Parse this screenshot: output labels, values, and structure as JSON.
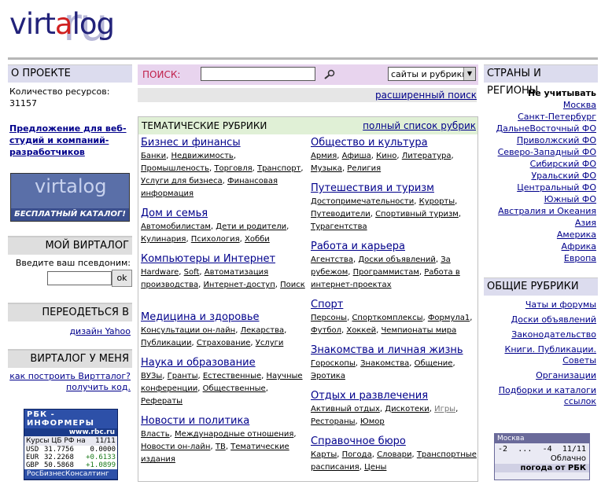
{
  "logo": {
    "main_pre": "virt",
    "main_dot": "a",
    "main_post": "log",
    "ru": "ru"
  },
  "about": {
    "header": "О ПРОЕКТЕ",
    "resources_label": "Количество ресурсов:",
    "resources_count": "31157",
    "offer_link": "Предложение для веб-студий и компаний-разработчиков",
    "banner_logo": "virtalog",
    "banner_text": "БЕСПЛАТНЫЙ КАТАЛОГ!"
  },
  "my_virtalog": {
    "header": "МОЙ ВИРТАЛОГ",
    "prompt": "Введите ваш псевдоним:",
    "input_value": "",
    "ok_label": "ok"
  },
  "dress": {
    "header": "ПЕРЕОДЕТЬСЯ В",
    "link": "дизайн Yahoo"
  },
  "mine": {
    "header": "ВИРТАЛОГ У МЕНЯ",
    "link": "как построить Виртталог? получить код."
  },
  "rbc": {
    "title": "РБК - ИНФОРМЕРЫ",
    "site": "www.rbc.ru",
    "caption": "Курсы ЦБ РФ на",
    "date": "11/11",
    "rows": [
      {
        "cur": "USD",
        "rate": "31.7756",
        "chg": "0.0000"
      },
      {
        "cur": "EUR",
        "rate": "32.2268",
        "chg": "+0.6133"
      },
      {
        "cur": "GBP",
        "rate": "50.5868",
        "chg": "+1.0899"
      }
    ],
    "footer": "РосБизнесКонсалтинг"
  },
  "search": {
    "label": "ПОИСК:",
    "value": "",
    "scope": "сайты и рубрики",
    "advanced": "расширенный поиск"
  },
  "rubrics": {
    "header": "ТЕМАТИЧЕСКИЕ РУБРИКИ",
    "full_list": "полный список рубрик",
    "left": [
      {
        "title": "Бизнес и финансы",
        "subs": [
          "Банки",
          "Недвижимость",
          "Промышленость",
          "Торговля",
          "Транспорт",
          "Услуги для бизнеса",
          "Финансовая информация"
        ]
      },
      {
        "title": "Дом и семья",
        "subs": [
          "Автомобилистам",
          "Дети и родители",
          "Кулинария",
          "Психология",
          "Хобби"
        ]
      },
      {
        "title": "Компьютеры и Интернет",
        "subs": [
          "Hardware",
          "Soft",
          "Автоматизация производства",
          "Интернет-доступ",
          "Поиск"
        ]
      },
      {
        "title": "Медицина и здоровье",
        "subs": [
          "Консультации он-лайн",
          "Лекарства",
          "Публикации",
          "Страхование",
          "Услуги"
        ]
      },
      {
        "title": "Наука и образование",
        "subs": [
          "ВУЗы",
          "Гранты",
          "Естественные",
          "Научные конференции",
          "Общественные",
          "Рефераты"
        ]
      },
      {
        "title": "Новости и политика",
        "subs": [
          "Власть",
          "Международные отношения",
          "Новости он-лайн",
          "ТВ",
          "Тематические издания"
        ]
      }
    ],
    "right": [
      {
        "title": "Общество и культура",
        "subs": [
          "Армия",
          "Афиша",
          "Кино",
          "Литература",
          "Музыка",
          "Религия"
        ]
      },
      {
        "title": "Путешествия и туризм",
        "subs": [
          "Достопримечательности",
          "Курорты",
          "Путеводители",
          "Спортивный туризм",
          "Турагентства"
        ]
      },
      {
        "title": "Работа и карьера",
        "subs": [
          "Агентства",
          "Доски объявлений",
          "За рубежом",
          "Программистам",
          "Работа в интернет-проектах"
        ]
      },
      {
        "title": "Спорт",
        "subs": [
          "Персоны",
          "Спорткомплексы",
          "Формула1",
          "Футбол",
          "Хоккей",
          "Чемпионаты мира"
        ]
      },
      {
        "title": "Знакомства и личная жизнь",
        "subs": [
          "Гороскопы",
          "Знакомства",
          "Общение",
          "Эротика"
        ]
      },
      {
        "title": "Отдых и развлечения",
        "subs": [
          "Активный отдых",
          "Дискотеки",
          "Игры",
          "Рестораны",
          "Юмор"
        ]
      },
      {
        "title": "Справочное бюро",
        "subs": [
          "Карты",
          "Погода",
          "Словари",
          "Транспортные расписания",
          "Цены"
        ]
      }
    ]
  },
  "regions": {
    "header": "СТРАНЫ И РЕГИОНЫ",
    "ignore": "Не учитывать",
    "items": [
      "Москва",
      "Санкт-Петербург",
      "ДальнеВосточный ФО",
      "Приволжский ФО",
      "Северо-Западный ФО",
      "Сибирский ФО",
      "Уральский ФО",
      "Центральный ФО",
      "Южный ФО",
      "Австралия и Океания",
      "Азия",
      "Америка",
      "Африка",
      "Европа"
    ]
  },
  "general": {
    "header": "ОБЩИЕ РУБРИКИ",
    "items": [
      "Чаты и форумы",
      "Доски объявлений",
      "Законодательство",
      "Книги. Публикации. Советы",
      "Организации",
      "Подборки и каталоги ссылок"
    ]
  },
  "weather": {
    "city": "Москва",
    "temp_from": "-2",
    "dots": "...",
    "temp_to": "-4",
    "date": "11/11",
    "condition": "Облачно",
    "by": "погода от РБК"
  }
}
